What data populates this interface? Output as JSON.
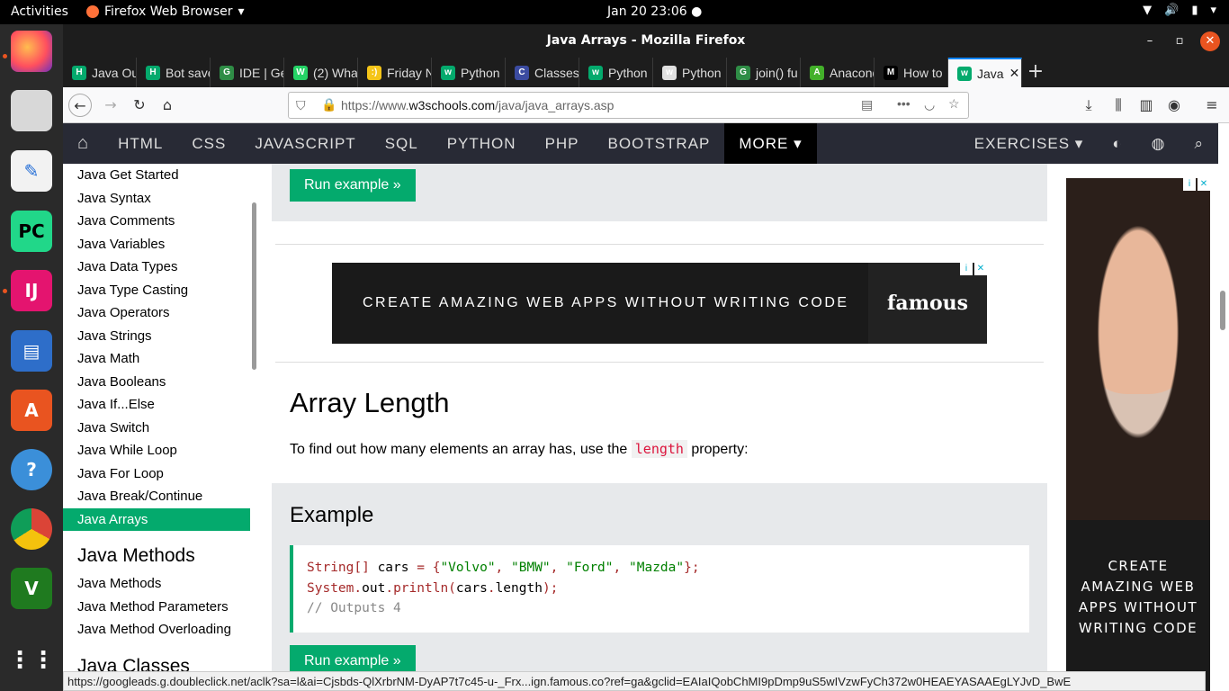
{
  "system": {
    "activities": "Activities",
    "app_menu": "Firefox Web Browser",
    "clock": "Jan 20  23:06"
  },
  "window": {
    "title": "Java Arrays - Mozilla Firefox"
  },
  "tabs": [
    {
      "label": "Java Ou",
      "favicon": "H",
      "color": "#04aa6d"
    },
    {
      "label": "Bot save",
      "favicon": "H",
      "color": "#04aa6d"
    },
    {
      "label": "IDE | Ge",
      "favicon": "G",
      "color": "#2f8d46"
    },
    {
      "label": "(2) What",
      "favicon": "W",
      "color": "#25d366"
    },
    {
      "label": "Friday N",
      "favicon": ":)",
      "color": "#f5c518"
    },
    {
      "label": "Python",
      "favicon": "w",
      "color": "#04aa6d"
    },
    {
      "label": "Classes",
      "favicon": "C",
      "color": "#3b4ba0"
    },
    {
      "label": "Python",
      "favicon": "w",
      "color": "#04aa6d"
    },
    {
      "label": "Python",
      "favicon": "w",
      "color": "#e0e0e0"
    },
    {
      "label": "join() fu",
      "favicon": "G",
      "color": "#2f8d46"
    },
    {
      "label": "Anacond",
      "favicon": "A",
      "color": "#43b02a"
    },
    {
      "label": "How to",
      "favicon": "M",
      "color": "#000000"
    },
    {
      "label": "Java",
      "favicon": "w",
      "color": "#04aa6d",
      "active": true
    }
  ],
  "urlbar": {
    "prefix": "https://www.",
    "domain": "w3schools.com",
    "path": "/java/java_arrays.asp"
  },
  "w3nav": {
    "items": [
      "HTML",
      "CSS",
      "JAVASCRIPT",
      "SQL",
      "PYTHON",
      "PHP",
      "BOOTSTRAP"
    ],
    "more": "MORE ▾",
    "exercises": "EXERCISES ▾"
  },
  "sidebar": {
    "items": [
      "Java Get Started",
      "Java Syntax",
      "Java Comments",
      "Java Variables",
      "Java Data Types",
      "Java Type Casting",
      "Java Operators",
      "Java Strings",
      "Java Math",
      "Java Booleans",
      "Java If...Else",
      "Java Switch",
      "Java While Loop",
      "Java For Loop",
      "Java Break/Continue",
      "Java Arrays"
    ],
    "active": "Java Arrays",
    "heading_methods": "Java Methods",
    "methods_items": [
      "Java Methods",
      "Java Method Parameters",
      "Java Method Overloading"
    ],
    "heading_classes": "Java Classes"
  },
  "main": {
    "run_example_label": "Run example »",
    "ad_text": "CREATE AMAZING WEB APPS WITHOUT WRITING CODE",
    "ad_brand": "famous",
    "heading": "Array Length",
    "para_before": "To find out how many elements an array has, use the ",
    "para_code": "length",
    "para_after": " property:",
    "example_heading": "Example",
    "code_line1_type": "String[]",
    "code_line1_var": " cars ",
    "code_line1_eq": "= {",
    "code_line1_s1": "\"Volvo\"",
    "code_line1_s2": "\"BMW\"",
    "code_line1_s3": "\"Ford\"",
    "code_line1_s4": "\"Mazda\"",
    "code_line1_end": "};",
    "code_line2_a": "System",
    "code_line2_b": "out",
    "code_line2_c": "println",
    "code_line2_d": "cars",
    "code_line2_e": "length",
    "code_line3": "// Outputs 4"
  },
  "right_ad": {
    "text": "CREATE AMAZING WEB APPS WITHOUT WRITING CODE"
  },
  "status": {
    "url": "https://googleads.g.doubleclick.net/aclk?sa=l&ai=Cjsbds-QlXrbrNM-DyAP7t7c45-u-_Frx...ign.famous.co?ref=ga&gclid=EAIaIQobChMI9pDmp9uS5wIVzwFyCh372w0HEAEYASAAEgLYJvD_BwE"
  },
  "colors": {
    "accent": "#04aa6d",
    "navbar": "#282a35",
    "firefox_blue": "#0a84ff"
  }
}
